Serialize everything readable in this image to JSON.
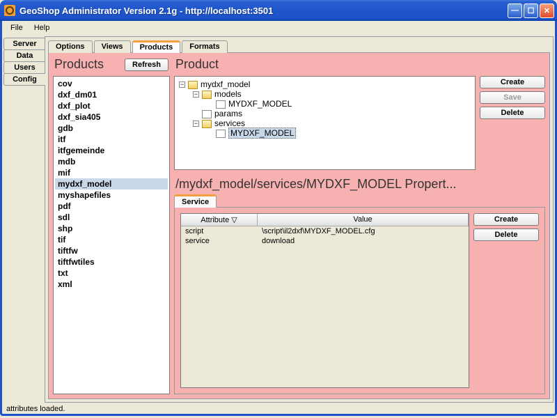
{
  "window": {
    "title": "GeoShop Administrator Version 2.1g - http://localhost:3501"
  },
  "menu": {
    "file": "File",
    "help": "Help"
  },
  "vtabs": {
    "server": "Server",
    "data": "Data",
    "users": "Users",
    "config": "Config"
  },
  "htabs": {
    "options": "Options",
    "views": "Views",
    "products": "Products",
    "formats": "Formats"
  },
  "products": {
    "title": "Products",
    "refresh": "Refresh",
    "items": [
      "cov",
      "dxf_dm01",
      "dxf_plot",
      "dxf_sia405",
      "gdb",
      "itf",
      "itfgemeinde",
      "mdb",
      "mif",
      "mydxf_model",
      "myshapefiles",
      "pdf",
      "sdl",
      "shp",
      "tif",
      "tiftfw",
      "tiftfwtiles",
      "txt",
      "xml"
    ],
    "selected": "mydxf_model"
  },
  "product": {
    "title": "Product",
    "create": "Create",
    "save": "Save",
    "delete": "Delete",
    "root": "mydxf_model",
    "models_label": "models",
    "models_child": "MYDXF_MODEL",
    "params_label": "params",
    "services_label": "services",
    "services_child": "MYDXF_MODEL"
  },
  "props": {
    "title": "/mydxf_model/services/MYDXF_MODEL Propert...",
    "tab": "Service",
    "col_attribute": "Attribute",
    "col_value": "Value",
    "rows": [
      {
        "attr": "script",
        "val": "\\script\\il2dxf\\MYDXF_MODEL.cfg"
      },
      {
        "attr": "service",
        "val": "download"
      }
    ],
    "create": "Create",
    "delete": "Delete"
  },
  "status": "attributes loaded."
}
